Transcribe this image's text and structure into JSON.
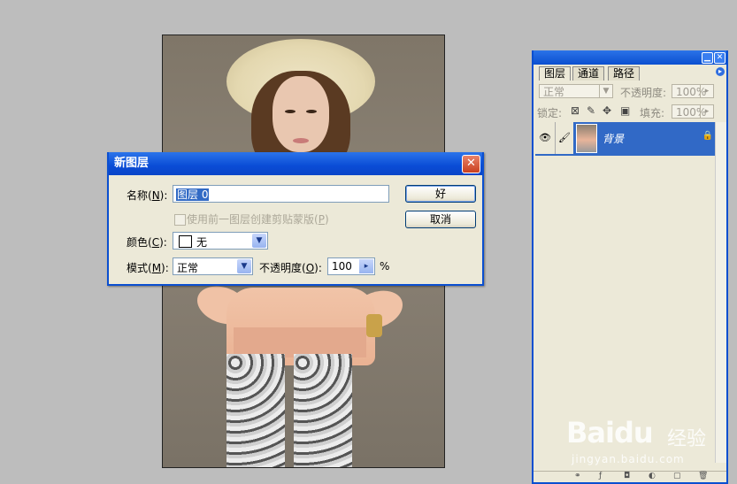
{
  "layers_panel": {
    "tabs": [
      "图层",
      "通道",
      "路径"
    ],
    "blend_mode": "正常",
    "opacity_label": "不透明度:",
    "opacity_value": "100%",
    "lock_label": "锁定:",
    "fill_label": "填充:",
    "fill_value": "100%",
    "layer_name": "背景"
  },
  "dialog": {
    "title": "新图层",
    "name_label": "名称(",
    "name_key": "N",
    "name_label_end": "):",
    "name_value": "图层 0",
    "clip_label": "使用前一图层创建剪贴蒙版(",
    "clip_key": "P",
    "clip_label_end": ")",
    "color_label": "颜色(",
    "color_key": "C",
    "color_label_end": "):",
    "color_value": "无",
    "mode_label": "模式(",
    "mode_key": "M",
    "mode_label_end": "):",
    "mode_value": "正常",
    "opacity_label": "不透明度(",
    "opacity_key": "O",
    "opacity_label_end": "):",
    "opacity_value": "100",
    "percent": "%",
    "ok_label": "好",
    "cancel_label": "取消"
  },
  "watermark": {
    "logo": "Baidu",
    "text": "经验",
    "url": "jingyan.baidu.com"
  }
}
